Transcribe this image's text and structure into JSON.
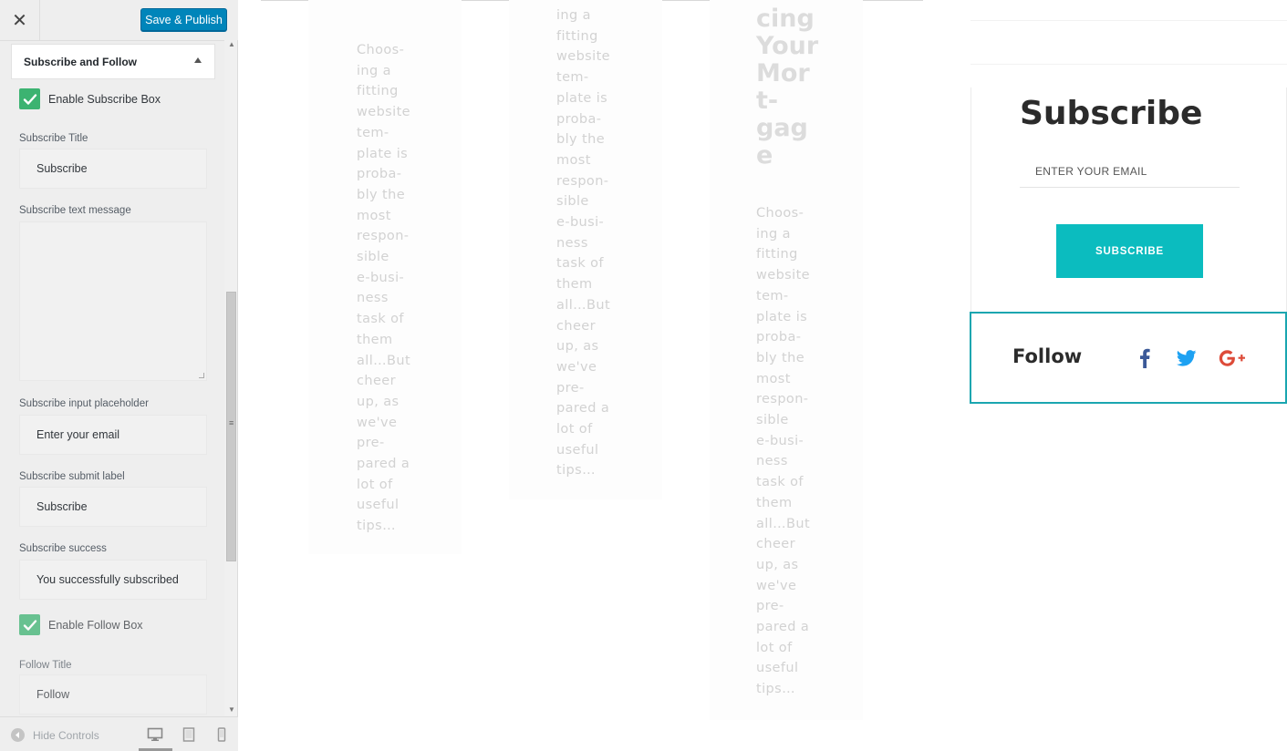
{
  "header": {
    "close_icon": "close-icon",
    "publish_label": "Save & Publish"
  },
  "section": {
    "title": "Subscribe and Follow",
    "toggle_icon": "triangle-up-icon"
  },
  "controls": {
    "enable_subscribe": {
      "label": "Enable Subscribe Box",
      "checked": true
    },
    "subscribe_title": {
      "label": "Subscribe Title",
      "value": "Subscribe"
    },
    "subscribe_text": {
      "label": "Subscribe text message",
      "value": ""
    },
    "subscribe_placeholder": {
      "label": "Subscribe input placeholder",
      "value": "Enter your email"
    },
    "subscribe_submit": {
      "label": "Subscribe submit label",
      "value": "Subscribe"
    },
    "subscribe_success": {
      "label": "Subscribe success",
      "value": "You successfully subscribed"
    },
    "enable_follow": {
      "label": "Enable Follow Box",
      "checked": true
    },
    "follow_title": {
      "label": "Follow Title",
      "value": "Follow"
    }
  },
  "footer": {
    "hide_controls_label": "Hide Controls",
    "devices": [
      "desktop-icon",
      "tablet-icon",
      "mobile-icon"
    ],
    "active_device": "desktop"
  },
  "preview": {
    "ghost_excerpt_1": [
      "Choos-",
      "ing a",
      "fitting",
      "website",
      "tem-",
      "plate is",
      "proba-",
      "bly the",
      "most",
      "respon-",
      "sible",
      "e-busi-",
      "ness",
      "task of",
      "them",
      "all…But",
      "cheer",
      "up, as",
      "we've",
      "pre-",
      "pared a",
      "lot of",
      "useful",
      "tips…"
    ],
    "ghost_excerpt_2": [
      "ing a",
      "fitting",
      "website",
      "tem-",
      "plate is",
      "proba-",
      "bly the",
      "most",
      "respon-",
      "sible",
      "e-busi-",
      "ness",
      "task of",
      "them",
      "all…But",
      "cheer",
      "up, as",
      "we've",
      "pre-",
      "pared a",
      "lot of",
      "useful",
      "tips…"
    ],
    "ghost_title_3": [
      "cing",
      "Your",
      "Mor",
      "t-",
      "gag",
      "e"
    ],
    "ghost_excerpt_3": [
      "Choos-",
      "ing a",
      "fitting",
      "website",
      "tem-",
      "plate is",
      "proba-",
      "bly the",
      "most",
      "respon-",
      "sible",
      "e-busi-",
      "ness",
      "task of",
      "them",
      "all…But",
      "cheer",
      "up, as",
      "we've",
      "pre-",
      "pared a",
      "lot of",
      "useful",
      "tips…"
    ],
    "subscribe": {
      "title": "Subscribe",
      "placeholder": "ENTER YOUR EMAIL",
      "button": "SUBSCRIBE",
      "button_color": "#0bbcbf"
    },
    "follow": {
      "title": "Follow",
      "border_color": "#1aa6b0",
      "icons": [
        {
          "name": "facebook-icon",
          "color": "#3b5998"
        },
        {
          "name": "twitter-icon",
          "color": "#1da1f2"
        },
        {
          "name": "google-plus-icon",
          "color": "#dd4b39"
        }
      ]
    }
  },
  "colors": {
    "accent": "#0085ba",
    "checkbox": "#3cb371"
  }
}
